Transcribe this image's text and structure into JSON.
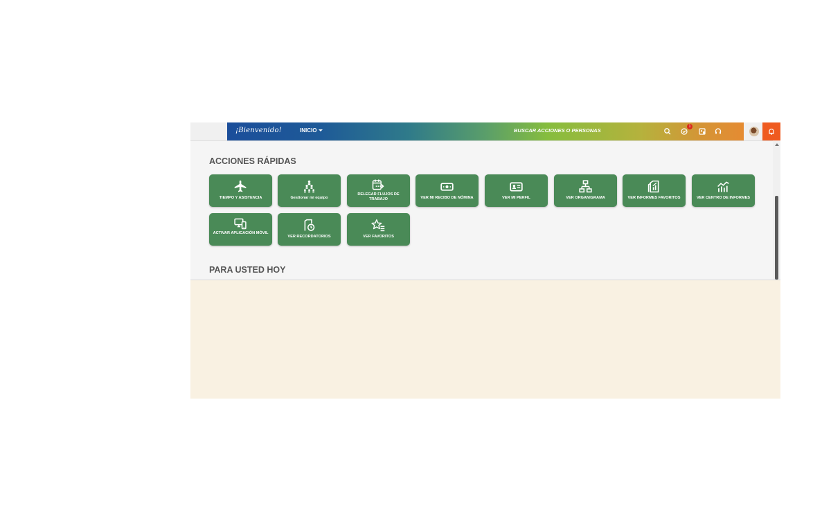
{
  "header": {
    "welcome": "¡Bienvenido!",
    "home_menu": "INICIO",
    "search_placeholder": "BUSCAR ACCIONES O PERSONAS",
    "notification_count": "1"
  },
  "quick_actions": {
    "title": "ACCIONES RÁPIDAS",
    "tiles": [
      {
        "label": "TIEMPO Y ASISTENCIA",
        "icon": "airplane-icon"
      },
      {
        "label": "Gestionar mi equipo",
        "icon": "team-icon"
      },
      {
        "label": "DELEGAR FLUJOS DE TRABAJO",
        "icon": "calendar-delegate-icon"
      },
      {
        "label": "VER MI RECIBO DE NÓMINA",
        "icon": "money-icon"
      },
      {
        "label": "VER MI PERFIL",
        "icon": "id-card-icon"
      },
      {
        "label": "VER ORGANIGRAMA",
        "icon": "org-chart-icon"
      },
      {
        "label": "VER INFORMES FAVORITOS",
        "icon": "report-icon"
      },
      {
        "label": "VER CENTRO DE INFORMES",
        "icon": "analytics-icon"
      },
      {
        "label": "ACTIVAR APLICACIÓN MÓVIL",
        "icon": "mobile-device-icon"
      },
      {
        "label": "VER RECORDATORIOS",
        "icon": "reminder-icon"
      },
      {
        "label": "VER FAVORITOS",
        "icon": "star-list-icon"
      }
    ]
  },
  "today": {
    "title": "PARA USTED HOY"
  },
  "colors": {
    "tile_green": "#4a8a57",
    "notification_red": "#d92a1c",
    "orange_block": "#ef5a1f"
  }
}
